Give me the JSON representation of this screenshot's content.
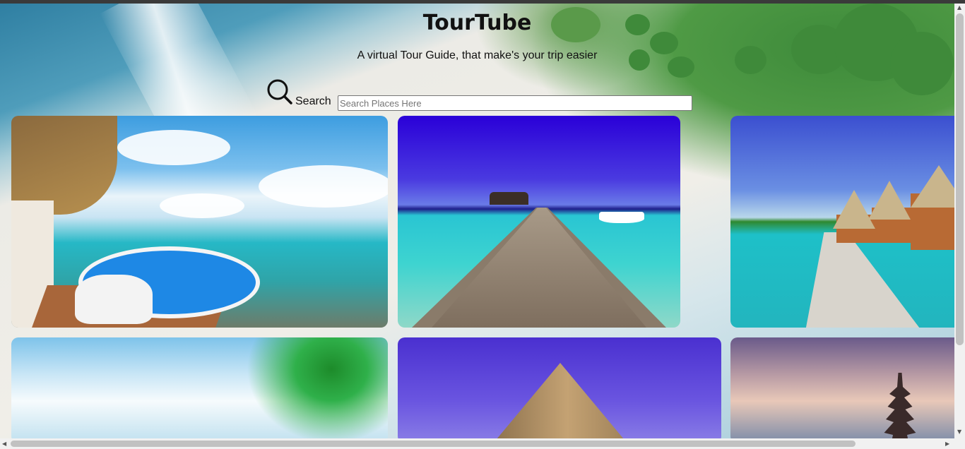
{
  "header": {
    "title": "TourTube",
    "subtitle": "A virtual Tour Guide, that make's your trip easier"
  },
  "search": {
    "label": "Search",
    "placeholder": "Search Places Here",
    "value": ""
  },
  "icons": [
    "search-icon",
    "scroll-up-arrow-icon",
    "scroll-down-arrow-icon",
    "scroll-left-arrow-icon",
    "scroll-right-arrow-icon"
  ],
  "places": [
    {
      "scene": "resort-pool"
    },
    {
      "scene": "jetty"
    },
    {
      "scene": "water-villas"
    },
    {
      "scene": "palm-beach"
    },
    {
      "scene": "pyramid"
    },
    {
      "scene": "temple"
    }
  ],
  "scroll": {
    "vertical_glyph_up": "▲",
    "vertical_glyph_down": "▼",
    "horizontal_glyph_left": "◀",
    "horizontal_glyph_right": "▶"
  }
}
